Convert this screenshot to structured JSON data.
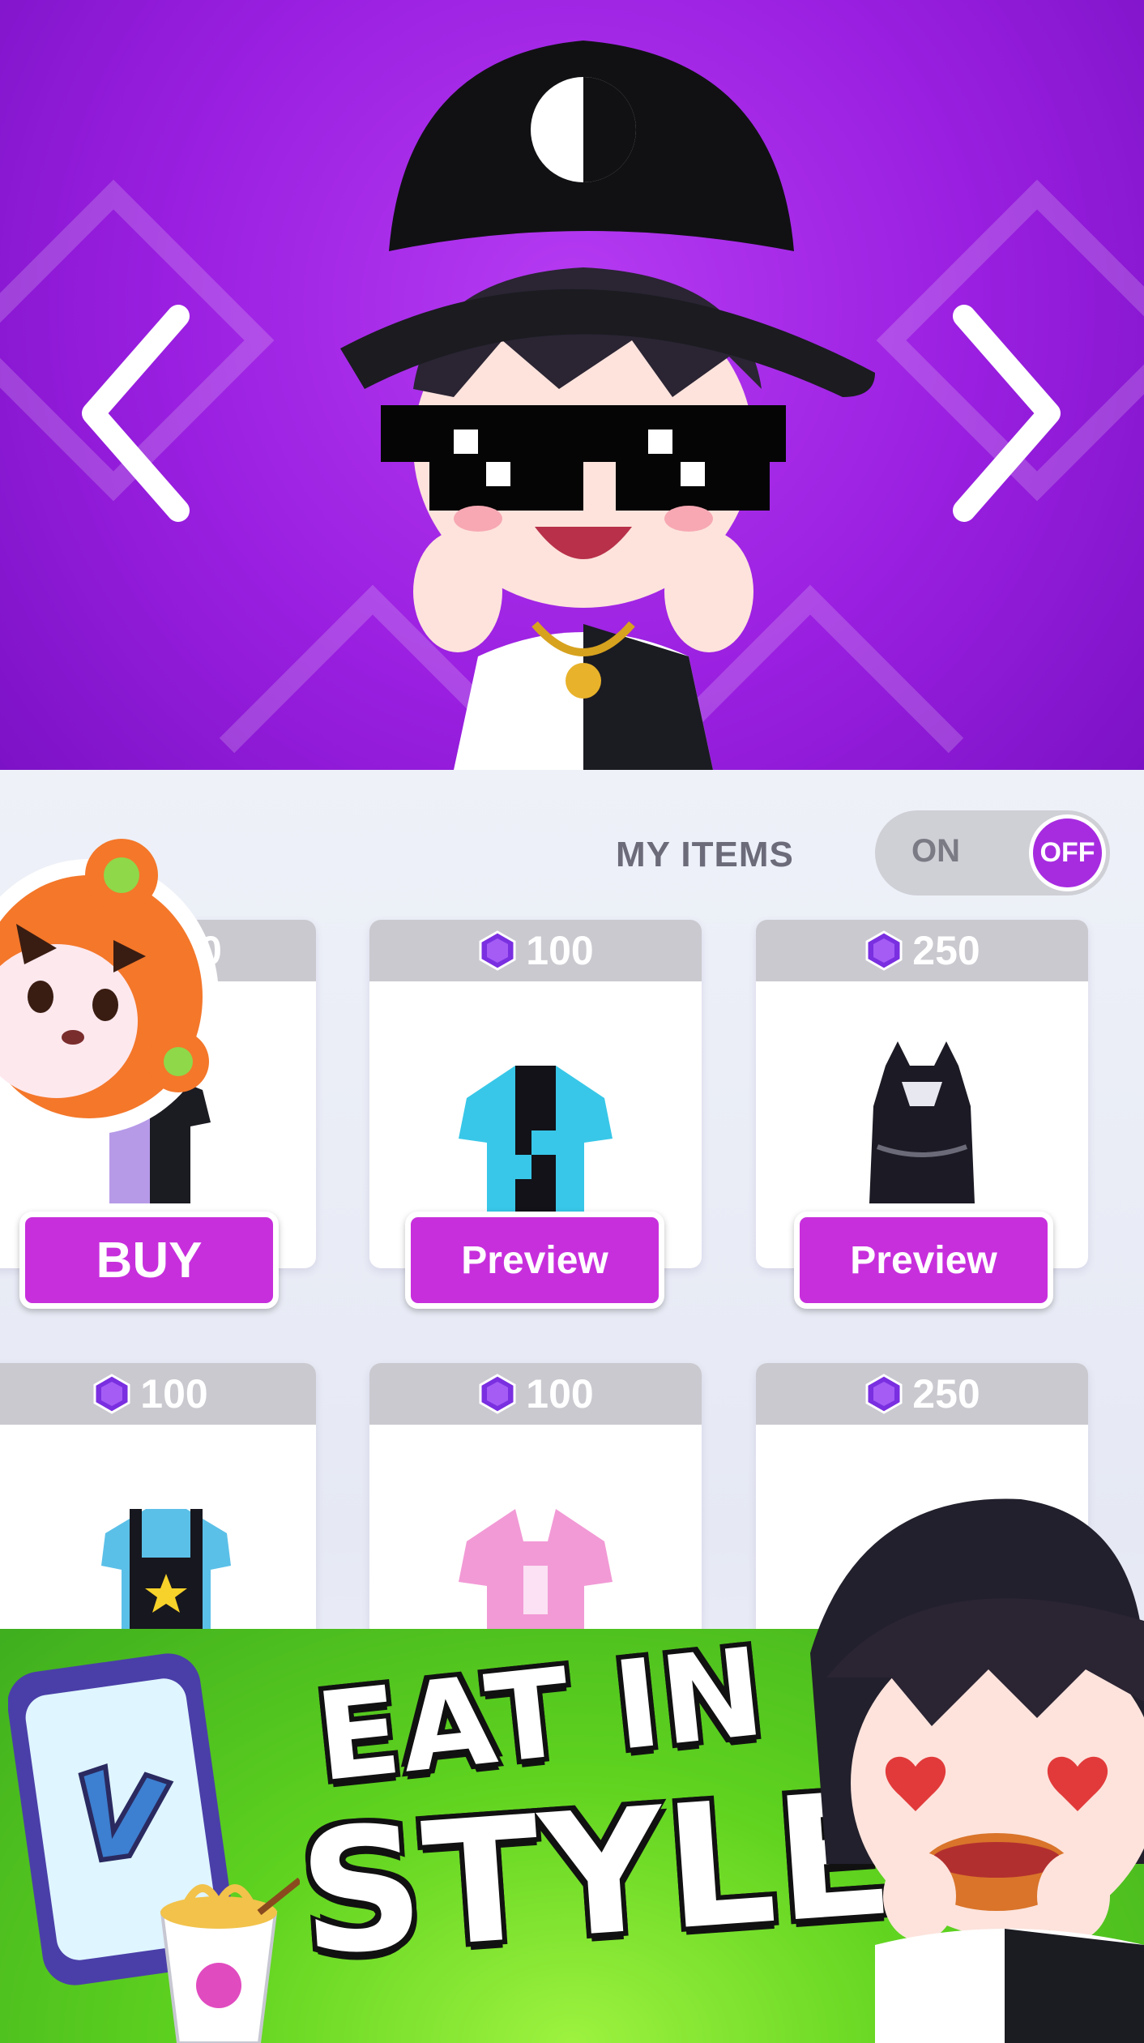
{
  "colors": {
    "hero_purple": "#9a1fe0",
    "button_magenta": "#c72fdc",
    "price_bar_gray": "#c9c9cf",
    "toggle_knob": "#a72ce0",
    "banner_green": "#5fd31f"
  },
  "hero": {
    "prev_icon": "chevron-left-icon",
    "next_icon": "chevron-right-icon",
    "avatar": "avatar-character-with-cap-and-pixel-sunglasses"
  },
  "filter": {
    "label": "MY ITEMS",
    "toggle_on_label": "ON",
    "toggle_off_label": "OFF",
    "state": "OFF"
  },
  "shop": {
    "items": [
      {
        "price": "0",
        "item": "black-purple-tshirt",
        "button": "BUY"
      },
      {
        "price": "100",
        "item": "blue-black-jacket",
        "button": "Preview"
      },
      {
        "price": "250",
        "item": "black-cat-hoodie",
        "button": "Preview"
      },
      {
        "price": "100",
        "item": "star-overalls",
        "button": ""
      },
      {
        "price": "100",
        "item": "pink-hoodie",
        "button": ""
      },
      {
        "price": "250",
        "item": "hidden-item",
        "button": ""
      }
    ]
  },
  "banner": {
    "slogan_line1": "EAT IN",
    "slogan_line2": "STYLE"
  }
}
